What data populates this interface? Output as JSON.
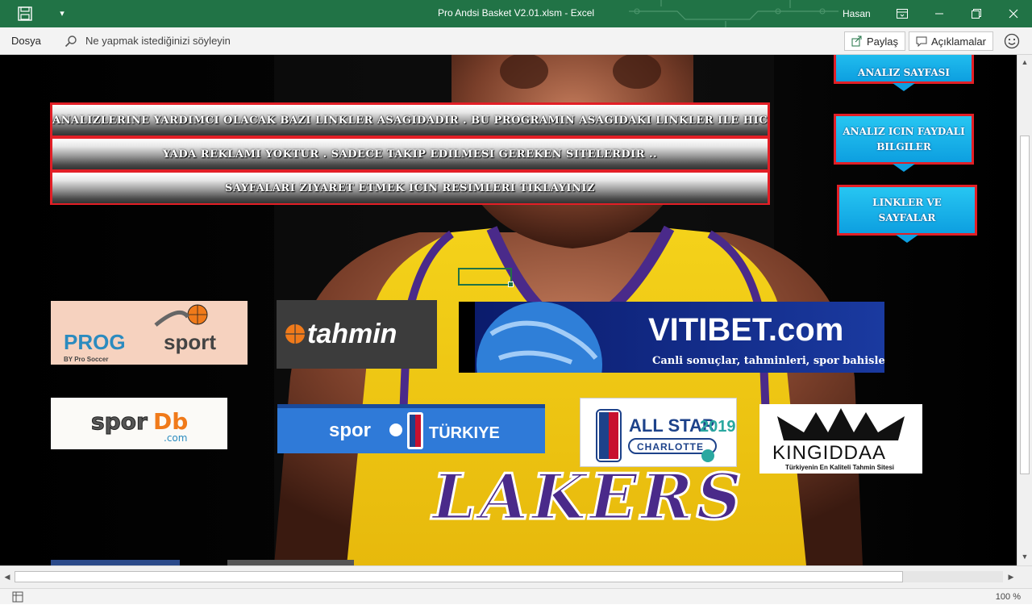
{
  "window": {
    "title": "Pro Andsi Basket V2.01.xlsm  -  Excel",
    "user": "Hasan"
  },
  "ribbon": {
    "file_tab": "Dosya",
    "tell_me": "Ne yapmak istediğinizi söyleyin",
    "share": "Paylaş",
    "comments": "Açıklamalar"
  },
  "banner": {
    "line1": "ANALIZLERINE YARDIMCI OLACAK BAZI LINKLER ASAGIDADIR . BU PROGRAMIN ASAGIDAKI LINKLER ILE HIC BIR BAGLANTISI",
    "line2": "YADA REKLAMI  YOKTUR . SADECE TAKIP EDILMESI GEREKEN SITELERDIR ..",
    "line3": "SAYFALARI ZIYARET ETMEK ICIN RESIMLERI TIKLAYINIZ"
  },
  "nav": {
    "analiz": "ANALIZ SAYFASI",
    "faydali_1": "ANALIZ ICIN FAYDALI",
    "faydali_2": "BILGILER",
    "linkler_1": "LINKLER VE",
    "linkler_2": "SAYFALAR"
  },
  "logos": {
    "progsport_a": "PROG",
    "progsport_b": "sport",
    "progsport_sub": "BY Pro Soccer",
    "tahmin": "tahmin",
    "vitibet": "VITIBET.com",
    "vitibet_sub": "Canli sonuçlar, tahminleri, spor bahisleri",
    "spordb_a": "spor",
    "spordb_b": "Db",
    "spordb_c": ".com",
    "sporx_a": "spor",
    "sporx_b": "TÜRKIYE",
    "allstar_a": "ALL STAR",
    "allstar_b": "2019",
    "allstar_c": "CHARLOTTE",
    "kingiddaa": "KINGIDDAA",
    "kingiddaa_sub": "Türkiyenin En Kaliteli Tahmin Sitesi"
  },
  "status": {
    "zoom": "100 %"
  },
  "colors": {
    "excel_green": "#217346",
    "banner_border": "#e21f26",
    "nav_blue": "#0d9fe0"
  }
}
